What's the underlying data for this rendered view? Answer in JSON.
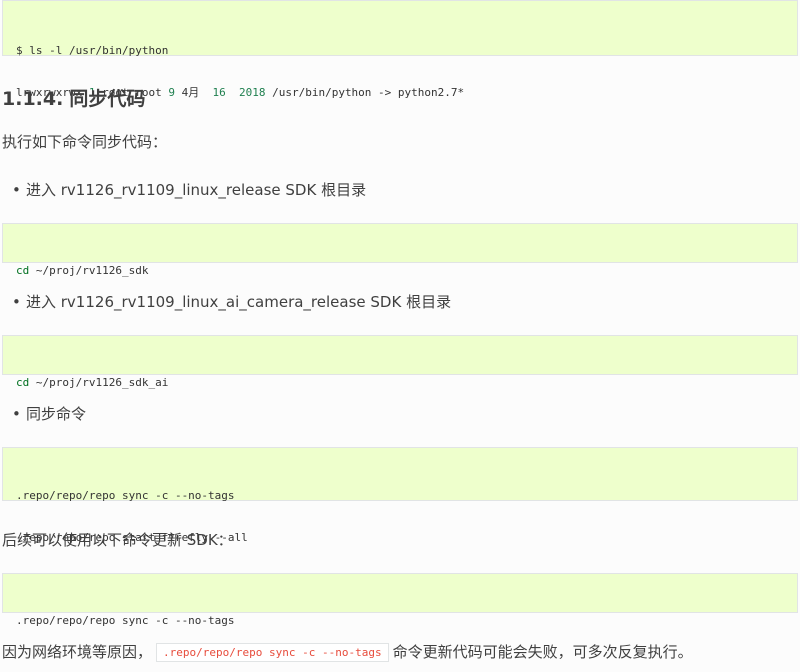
{
  "code_top": {
    "line1": "$ ls -l /usr/bin/python",
    "line2_perm": "lrwxrwxrwx ",
    "line2_links": "1",
    "line2_owner": " root root ",
    "line2_size": "9",
    "line2_month": " 4月  ",
    "line2_day": "16",
    "line2_sp": "  ",
    "line2_year": "2018",
    "line2_rest": " /usr/bin/python -> python2.7*"
  },
  "section": {
    "number": "1.1.4.",
    "title": "同步代码"
  },
  "intro": "执行如下命令同步代码：",
  "bullets": {
    "b1": "进入 rv1126_rv1109_linux_release SDK 根目录",
    "b2": "进入 rv1126_rv1109_linux_ai_camera_release SDK 根目录",
    "b3": "同步命令"
  },
  "code_cd1": {
    "cmd": "cd",
    "arg": " ~/proj/rv1126_sdk"
  },
  "code_cd2": {
    "cmd": "cd",
    "arg": " ~/proj/rv1126_sdk_ai"
  },
  "code_sync": {
    "line1": ".repo/repo/repo sync -c --no-tags",
    "line2": ".repo/repo/repo start firefly --all"
  },
  "update_text": "后续可以使用以下命令更新 SDK：",
  "code_update": {
    "line1": ".repo/repo/repo sync -c --no-tags"
  },
  "note": {
    "before": "因为网络环境等原因，",
    "code": ".repo/repo/repo sync -c --no-tags",
    "after": "命令更新代码可能会失败，可多次反复执行。"
  }
}
